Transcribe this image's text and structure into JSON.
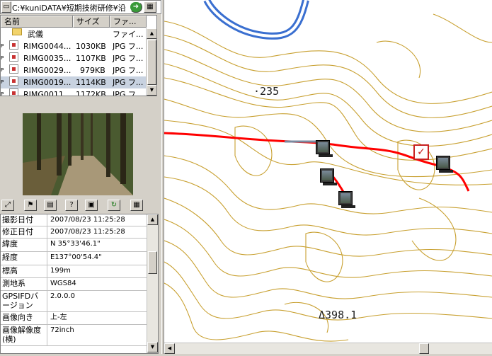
{
  "path": {
    "text": "C:¥kuniDATA¥短期技術研修¥沿"
  },
  "filelist": {
    "headers": {
      "name": "名前",
      "size": "サイズ",
      "type": "ファ..."
    },
    "folder": {
      "name": "武儀",
      "type": "ファイ..."
    },
    "files": [
      {
        "name": "RIMG0044...",
        "size": "1030KB",
        "type": "JPG フ..."
      },
      {
        "name": "RIMG0035...",
        "size": "1107KB",
        "type": "JPG フ..."
      },
      {
        "name": "RIMG0029...",
        "size": "979KB",
        "type": "JPG フ..."
      },
      {
        "name": "RIMG0019...",
        "size": "1114KB",
        "type": "JPG フ...",
        "selected": true
      },
      {
        "name": "RIMG0011...",
        "size": "1172KB",
        "type": "JPG フ..."
      }
    ]
  },
  "properties": [
    {
      "key": "撮影日付",
      "value": "2007/08/23 11:25:28"
    },
    {
      "key": "修正日付",
      "value": "2007/08/23 11:25:28"
    },
    {
      "key": "緯度",
      "value": "N 35°33'46.1\""
    },
    {
      "key": "経度",
      "value": "E137°00'54.4\""
    },
    {
      "key": "標高",
      "value": "199m"
    },
    {
      "key": "測地系",
      "value": "WGS84"
    },
    {
      "key": "GPSIFDバージョン",
      "value": "2.0.0.0"
    },
    {
      "key": "画像向き",
      "value": "上-左"
    },
    {
      "key": "画像解像度(横)",
      "value": "72inch"
    }
  ],
  "map": {
    "labels": {
      "elev1": "·235",
      "elev2": "Δ398.1"
    },
    "colors": {
      "contour": "#c8a030",
      "track": "#ff0000",
      "river": "#3a6fd0"
    }
  }
}
